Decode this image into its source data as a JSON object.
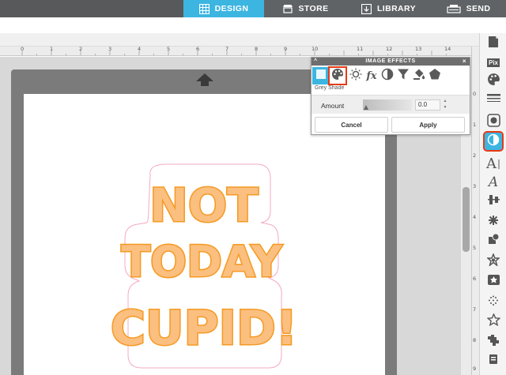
{
  "nav": {
    "tabs": [
      {
        "label": "DESIGN",
        "icon": "grid-icon",
        "active": true
      },
      {
        "label": "STORE",
        "icon": "store-icon",
        "active": false
      },
      {
        "label": "LIBRARY",
        "icon": "library-icon",
        "active": false
      },
      {
        "label": "SEND",
        "icon": "send-icon",
        "active": false
      }
    ],
    "accent_color": "#3cb5e0"
  },
  "ruler": {
    "h_numbers": [
      "0",
      "1",
      "2",
      "3",
      "4",
      "5",
      "6",
      "7",
      "8",
      "9",
      "10",
      "11",
      "12",
      "13",
      "14"
    ],
    "v_numbers": [
      "0",
      "1",
      "2",
      "3",
      "4",
      "5",
      "6",
      "7",
      "8",
      "9"
    ]
  },
  "panel": {
    "title": "IMAGE EFFECTS",
    "collapse_glyph": "^",
    "close_glyph": "×",
    "effects": [
      {
        "icon": "blank-effect-icon",
        "selected": true
      },
      {
        "icon": "palette-icon",
        "highlighted": true
      },
      {
        "icon": "brightness-sun-icon"
      },
      {
        "icon": "fx-icon",
        "label": "fx"
      },
      {
        "icon": "contrast-icon"
      },
      {
        "icon": "funnel-filter-icon"
      },
      {
        "icon": "paint-bucket-icon"
      },
      {
        "icon": "pentagon-icon"
      }
    ],
    "effect_name": "Grey Shade",
    "amount_label": "Amount",
    "amount_value": "0.0",
    "slider_level": 0,
    "cancel_label": "Cancel",
    "apply_label": "Apply"
  },
  "artwork": {
    "lines": [
      "NOT",
      "TODAY",
      "CUPID!"
    ],
    "fill_color": "#fbbf7f",
    "outline_color": "#f59a23",
    "border_color": "#f4a9c4"
  },
  "right_toolbar": [
    {
      "icon": "page-setup-icon"
    },
    {
      "icon": "pixscan-icon",
      "label": "Pix"
    },
    {
      "icon": "fill-palette-icon"
    },
    {
      "icon": "line-style-icon"
    },
    {
      "icon": "trace-icon"
    },
    {
      "icon": "image-effects-icon",
      "active": true,
      "highlighted": true
    },
    {
      "icon": "text-icon",
      "label": "A"
    },
    {
      "icon": "text-style-icon",
      "label": "A"
    },
    {
      "icon": "align-icon"
    },
    {
      "icon": "replicate-icon"
    },
    {
      "icon": "transform-icon"
    },
    {
      "icon": "modify-icon"
    },
    {
      "icon": "offset-star-icon"
    },
    {
      "icon": "library-heart-icon"
    },
    {
      "icon": "sketch-dots-icon"
    },
    {
      "icon": "star-outline-icon"
    },
    {
      "icon": "puzzle-icon"
    },
    {
      "icon": "send-cut-icon"
    }
  ]
}
